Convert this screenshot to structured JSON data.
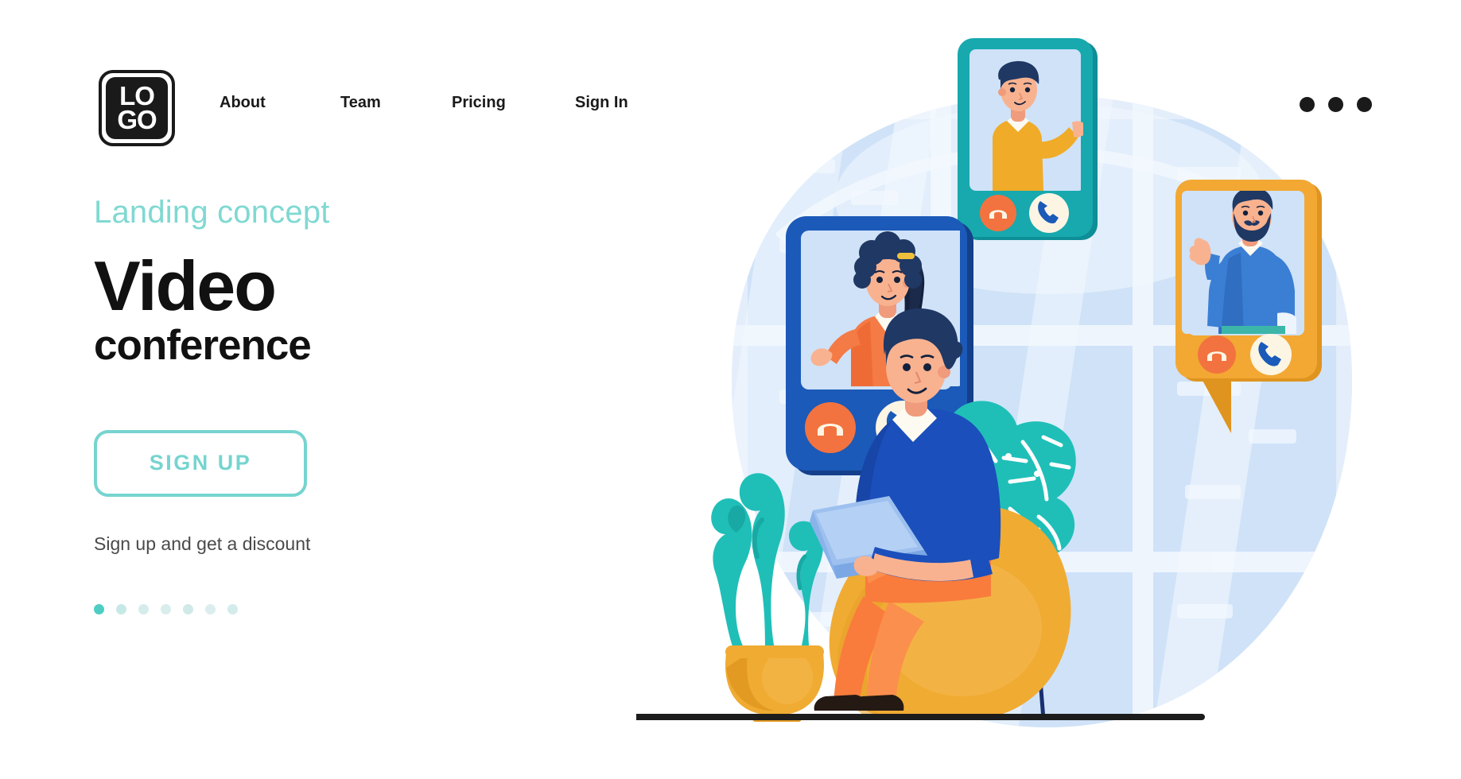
{
  "nav": {
    "logo": {
      "line1": "LO",
      "line2": "GO",
      "name": "logo"
    },
    "links": [
      {
        "label": "About"
      },
      {
        "label": "Team"
      },
      {
        "label": "Pricing"
      },
      {
        "label": "Sign In"
      }
    ],
    "menu_icon": "more-horizontal-icon"
  },
  "hero": {
    "eyebrow": "Landing concept",
    "title": "Video",
    "subtitle": "conference",
    "cta_label": "SIGN UP",
    "note": "Sign up and get a discount",
    "dots": [
      {
        "active": true,
        "color": "#4ecdc4"
      },
      {
        "active": false,
        "color": "#c6e9e7"
      },
      {
        "active": false,
        "color": "#d5eceb"
      },
      {
        "active": false,
        "color": "#d8edec"
      },
      {
        "active": false,
        "color": "#cfeae8"
      },
      {
        "active": false,
        "color": "#dbeeed"
      },
      {
        "active": false,
        "color": "#d3eceb"
      }
    ]
  },
  "colors": {
    "accent_teal": "#76d4cf",
    "eyebrow_teal": "#7fd9d2",
    "title_black": "#111111",
    "note_gray": "#4a4a4a",
    "card_blue": "#1b5ab8",
    "card_teal": "#17a9ae",
    "card_yellow": "#f2a833",
    "decline_orange": "#f2733f",
    "accept_cream": "#fdf5e3",
    "skin": "#f7a98a",
    "hair_navy": "#1f3864",
    "shirt_orange": "#f47b45",
    "sweater_yellow": "#f0ab28",
    "sweater_blue": "#3b7fd4",
    "sitter_sweater": "#1b4fbb",
    "pants_orange": "#f97c3c",
    "beanbag_yellow": "#f0ab33",
    "plant_teal": "#1fbfb8",
    "pot_yellow": "#f0ab33",
    "pot_blue": "#17499b",
    "bg_blob": "#e8f1fb",
    "window_blue": "#c7deF6",
    "floor_line": "#1c1c1c"
  },
  "illustration": {
    "name": "video-conference-illustration",
    "scene": "person-on-beanbag-with-laptop-video-calls",
    "cards": [
      {
        "name": "video-call-card-woman",
        "color": "#1b5ab8",
        "person": "woman-orange-shirt",
        "decline_icon": "phone-down-icon",
        "accept_icon": "phone-icon"
      },
      {
        "name": "video-call-card-man-yellow",
        "color": "#17a9ae",
        "person": "man-yellow-sweater",
        "decline_icon": "phone-down-icon",
        "accept_icon": "phone-icon"
      },
      {
        "name": "video-call-card-man-beard",
        "color": "#f2a833",
        "person": "bearded-man-blue-sweater",
        "decline_icon": "phone-down-icon",
        "accept_icon": "phone-icon"
      }
    ],
    "objects": [
      {
        "name": "seated-man-with-laptop"
      },
      {
        "name": "bean-bag-chair"
      },
      {
        "name": "laptop"
      },
      {
        "name": "wavy-plant-in-yellow-pot"
      },
      {
        "name": "monstera-plant-on-stand"
      },
      {
        "name": "window-background"
      },
      {
        "name": "floor-line"
      }
    ]
  }
}
